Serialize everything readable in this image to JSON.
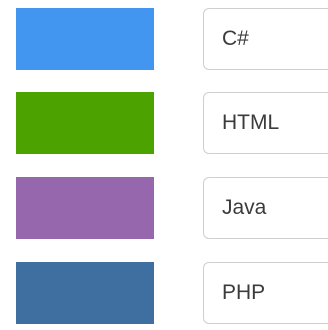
{
  "items": [
    {
      "label": "C#",
      "color": "#4396F0"
    },
    {
      "label": "HTML",
      "color": "#4CA300"
    },
    {
      "label": "Java",
      "color": "#9767AD"
    },
    {
      "label": "PHP",
      "color": "#3E6FA0"
    }
  ]
}
